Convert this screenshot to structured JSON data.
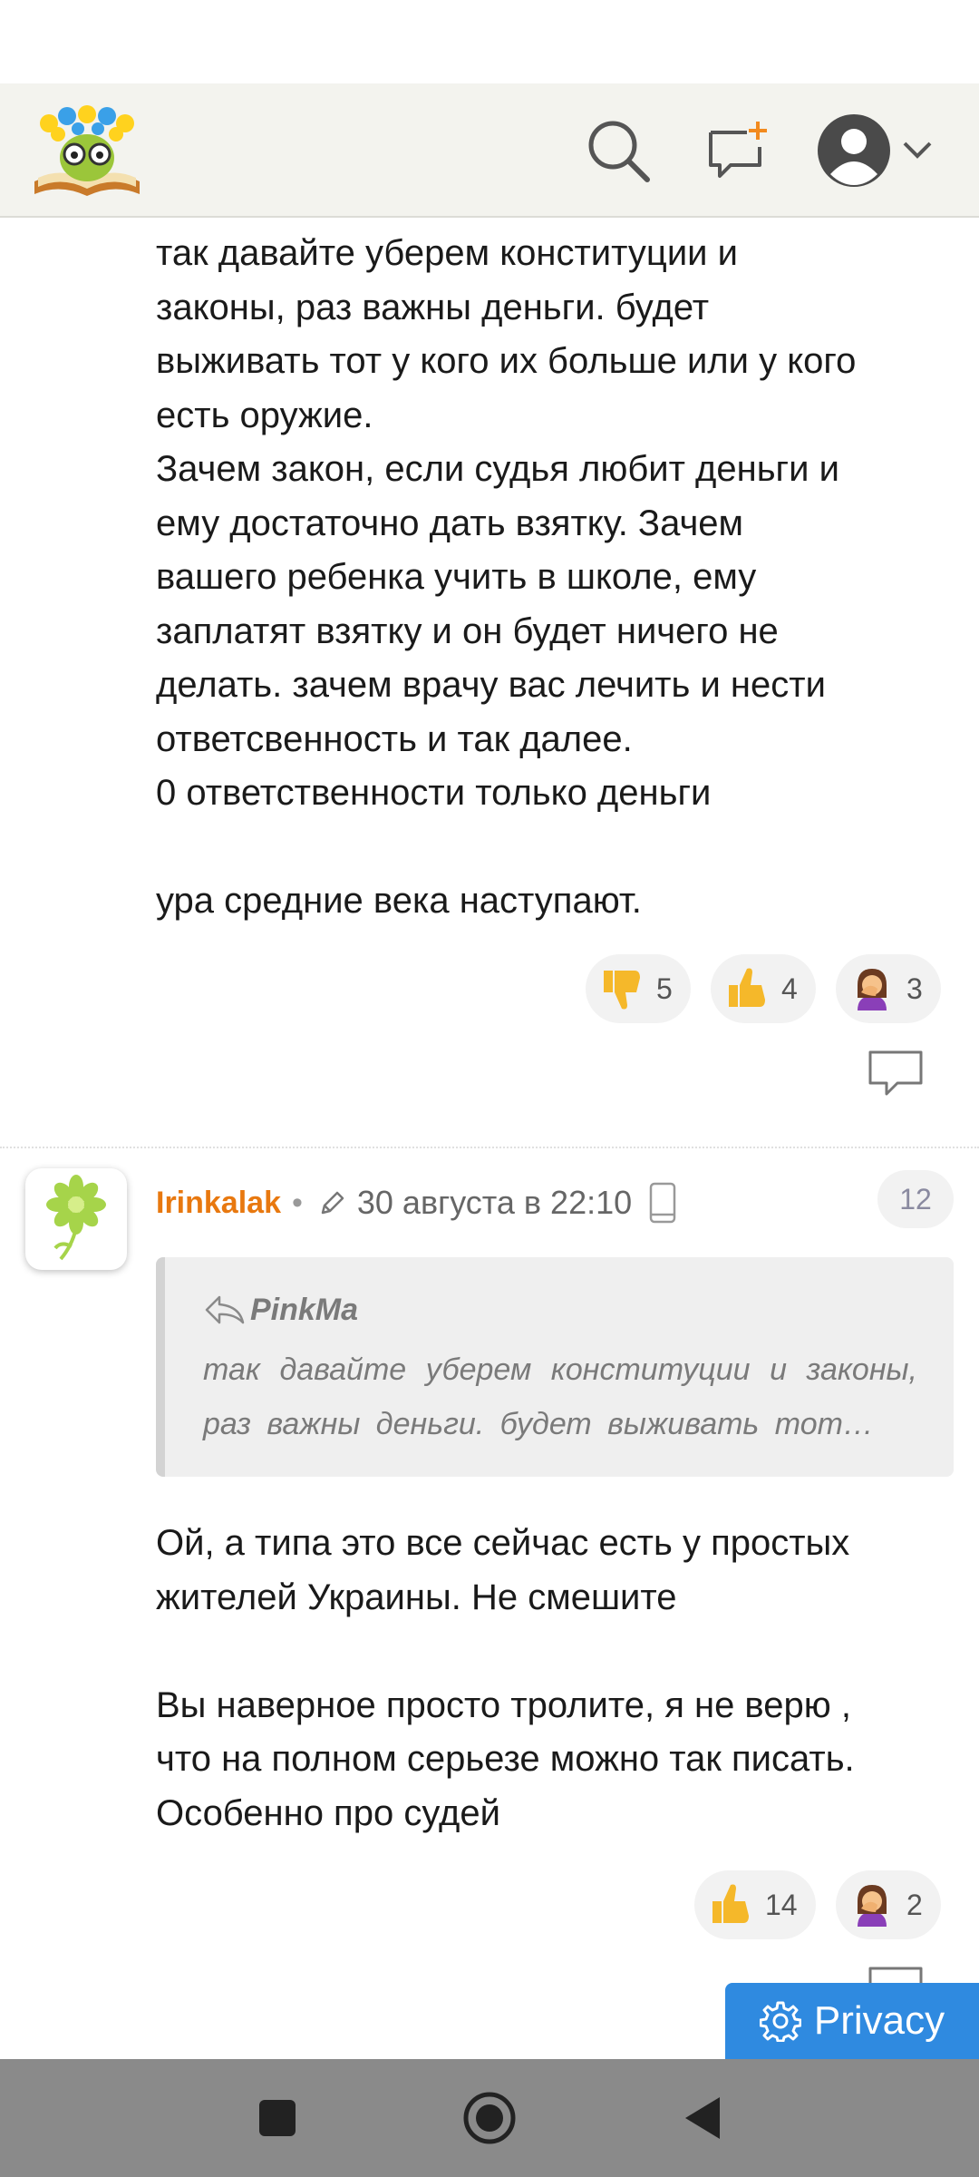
{
  "comment1": {
    "text": "так давайте уберем конституции и\nзаконы, раз важны деньги. будет\nвыживать тот у кого их больше или у кого\nесть оружие.\nЗачем закон, если судья любит деньги и\nему достаточно дать взятку. Зачем\nвашего ребенка учить в школе, ему\nзаплатят взятку и он будет ничего не\nделать. зачем врачу вас лечить и нести\nответсвенность и так далее.\n0 ответственности только деньги\n\nура средние века наступают.",
    "reactions": [
      {
        "icon": "thumbs-down-icon",
        "count": "5"
      },
      {
        "icon": "thumbs-up-icon",
        "count": "4"
      },
      {
        "icon": "facepalm-icon",
        "count": "3"
      }
    ]
  },
  "comment2": {
    "author": "Irinkalak",
    "separator": "•",
    "date": "30 августа в 22:10",
    "number": "12",
    "quote": {
      "author": "PinkMa",
      "text": "так давайте уберем конституции и законы, раз важны деньги. будет выживать тот…"
    },
    "text": "Ой, а типа это все сейчас есть у простых\nжителей Украины. Не смешите\n\nВы наверное просто тролите, я не верю ,\nчто на полном серьезе можно так писать.\nОсобенно про судей",
    "reactions": [
      {
        "icon": "thumbs-up-icon",
        "count": "14"
      },
      {
        "icon": "facepalm-icon",
        "count": "2"
      }
    ]
  },
  "privacy": {
    "label": "Privacy"
  },
  "colors": {
    "author": "#e8780f",
    "privacy_bg": "#2f8ae0",
    "header_bg": "#f3f3ee",
    "nav_bg": "#8a8a8a"
  }
}
